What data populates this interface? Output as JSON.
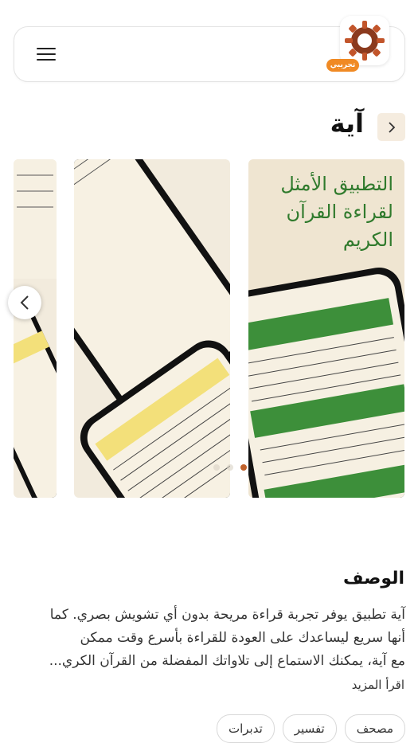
{
  "header": {
    "menu_icon": "hamburger-menu-icon",
    "logo_icon": "app-logo-icon",
    "beta_label": "تجريبي"
  },
  "app": {
    "title": "آية",
    "back_icon": "chevron-right-icon"
  },
  "gallery": {
    "screenshot_1_text": [
      "التطبيق الأمثل",
      "لقراءة القرآن",
      "الكريم"
    ],
    "prev_icon": "chevron-left-icon",
    "dots_count": 3,
    "active_dot": 0
  },
  "description": {
    "heading": "الوصف",
    "lines": [
      "آية تطبيق يوفر تجربة قراءة مريحة بدون أي تشويش بصري. كما",
      "أنها سريع ليساعدك على العودة للقراءة بأسرع وقت ممكن",
      "مع آية، يمكنك الاستماع إلى تلاواتك المفضلة من القرآن الكري..."
    ],
    "read_more": "اقرأ المزيد"
  },
  "tags": [
    "مصحف",
    "تفسير",
    "تدبرات"
  ],
  "colors": {
    "accent": "#f08a24",
    "logo_brown": "#8b3a1e",
    "screenshot_bg": "#eadfc9",
    "quran_green": "#3d8f3a",
    "dot_active": "#c0612b"
  }
}
